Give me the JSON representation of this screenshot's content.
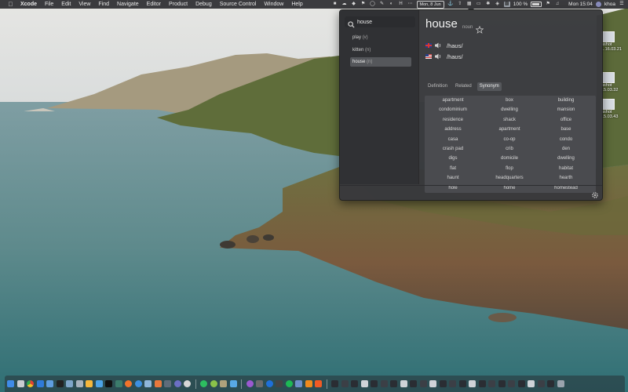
{
  "menubar": {
    "app_name": "Xcode",
    "menus": [
      "File",
      "Edit",
      "View",
      "Find",
      "Navigate",
      "Editor",
      "Product",
      "Debug",
      "Source Control",
      "Window",
      "Help"
    ],
    "status": {
      "date_pill": "Mon, 8 Jun",
      "battery": "100 %",
      "clock": "Mon 15:04",
      "user": "khoa"
    }
  },
  "desktop": {
    "files": [
      {
        "name_line1": "nshot",
        "name_line2": "1.16.03.21"
      },
      {
        "name_line1": "nshot",
        "name_line2": "15.03.32"
      },
      {
        "name_line1": "nshot",
        "name_line2": "15.03.43"
      }
    ]
  },
  "dictionary": {
    "search": {
      "value": "house",
      "placeholder": ""
    },
    "history": [
      {
        "word": "play",
        "pos": "(v)"
      },
      {
        "word": "kitten",
        "pos": "(n)"
      },
      {
        "word": "house",
        "pos": "(n)"
      }
    ],
    "entry": {
      "headword": "house",
      "pos": "noun",
      "pronunciations": [
        {
          "region": "uk",
          "ipa": "/haʊs/"
        },
        {
          "region": "us",
          "ipa": "/haʊs/"
        }
      ]
    },
    "tabs": [
      "Definition",
      "Related",
      "Synonym"
    ],
    "active_tab": "Synonym",
    "synonyms": [
      "apartment",
      "box",
      "building",
      "condominium",
      "dwelling",
      "mansion",
      "residence",
      "shack",
      "office",
      "address",
      "apartment",
      "base",
      "casa",
      "co-op",
      "condo",
      "crash pad",
      "crib",
      "den",
      "digs",
      "domicile",
      "dwelling",
      "flat",
      "flop",
      "habitat",
      "haunt",
      "headquarters",
      "hearth",
      "hole",
      "home",
      "homestead"
    ]
  },
  "colors": {
    "menubar": "#2d2d30",
    "popover": "#38393c",
    "synonym_panel": "#4a4b4f",
    "selection": "#55575b"
  },
  "dock": {
    "icons": [
      "finder",
      "launchpad",
      "chrome",
      "xcode",
      "files",
      "terminal",
      "safari",
      "firefox",
      "preview",
      "sketch",
      "git",
      "music",
      "evernote",
      "slack",
      "messages",
      "podcasts",
      "ibooks",
      "1password",
      "spotify",
      "vlc",
      "brave"
    ]
  }
}
